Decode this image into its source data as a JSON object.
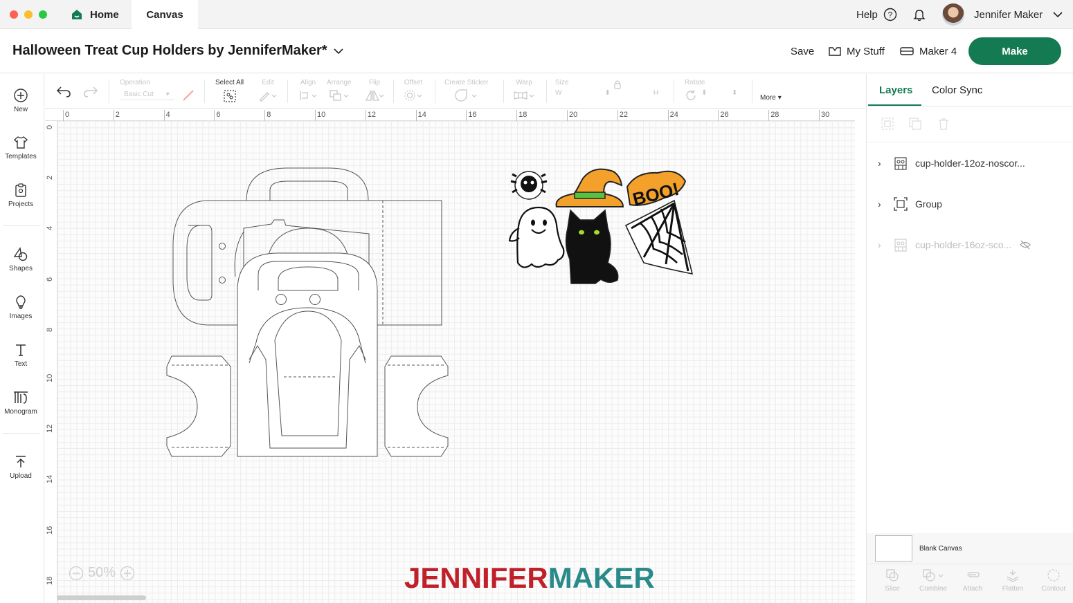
{
  "titlebar": {
    "home_tab": "Home",
    "canvas_tab": "Canvas",
    "help": "Help",
    "user_name": "Jennifer Maker"
  },
  "header": {
    "project_title": "Halloween Treat Cup Holders by JenniferMaker*",
    "save": "Save",
    "my_stuff": "My Stuff",
    "machine": "Maker 4",
    "make": "Make"
  },
  "leftbar": {
    "items": [
      {
        "label": "New"
      },
      {
        "label": "Templates"
      },
      {
        "label": "Projects"
      },
      {
        "label": "Shapes"
      },
      {
        "label": "Images"
      },
      {
        "label": "Text"
      },
      {
        "label": "Monogram"
      },
      {
        "label": "Upload"
      }
    ]
  },
  "toolbar": {
    "operation": "Operation",
    "operation_value": "Basic Cut",
    "select_all": "Select All",
    "edit": "Edit",
    "align": "Align",
    "arrange": "Arrange",
    "flip": "Flip",
    "offset": "Offset",
    "create_sticker": "Create Sticker",
    "warp": "Warp",
    "size": "Size",
    "w": "W",
    "h": "H",
    "rotate": "Rotate",
    "more": "More"
  },
  "rulers": {
    "top": [
      "0",
      "2",
      "4",
      "6",
      "8",
      "10",
      "12",
      "14",
      "16",
      "18",
      "20",
      "22",
      "24",
      "26",
      "28",
      "30"
    ],
    "left": [
      "0",
      "2",
      "4",
      "6",
      "8",
      "10",
      "12",
      "14",
      "16",
      "18"
    ]
  },
  "zoom": {
    "level": "50%"
  },
  "watermark": {
    "part1": "JENNIFER",
    "part2": "MAKER"
  },
  "panel": {
    "tab_layers": "Layers",
    "tab_color_sync": "Color Sync",
    "layers": [
      {
        "name": "cup-holder-12oz-noscor..."
      },
      {
        "name": "Group"
      },
      {
        "name": "cup-holder-16oz-sco..."
      }
    ],
    "blank_canvas": "Blank Canvas",
    "bottom_tools": [
      {
        "label": "Slice"
      },
      {
        "label": "Combine"
      },
      {
        "label": "Attach"
      },
      {
        "label": "Flatten"
      },
      {
        "label": "Contour"
      }
    ]
  },
  "colors": {
    "accent": "#147a52",
    "active_tab": "#147a52",
    "watermark_red": "#c0202a",
    "watermark_teal": "#2a8a8a",
    "hat": "#f3a12a"
  }
}
